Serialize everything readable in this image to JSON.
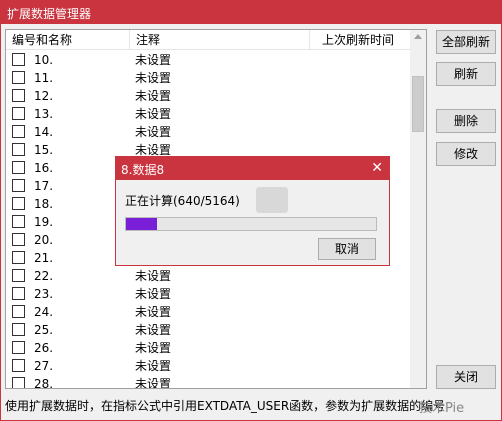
{
  "window": {
    "title": "扩展数据管理器"
  },
  "list": {
    "columns": [
      "编号和名称",
      "注释",
      "上次刷新时间"
    ],
    "rows": [
      {
        "num": "10.",
        "note": "未设置"
      },
      {
        "num": "11.",
        "note": "未设置"
      },
      {
        "num": "12.",
        "note": "未设置"
      },
      {
        "num": "13.",
        "note": "未设置"
      },
      {
        "num": "14.",
        "note": "未设置"
      },
      {
        "num": "15.",
        "note": "未设置"
      },
      {
        "num": "16.",
        "note": ""
      },
      {
        "num": "17.",
        "note": ""
      },
      {
        "num": "18.",
        "note": ""
      },
      {
        "num": "19.",
        "note": ""
      },
      {
        "num": "20.",
        "note": ""
      },
      {
        "num": "21.",
        "note": ""
      },
      {
        "num": "22.",
        "note": "未设置"
      },
      {
        "num": "23.",
        "note": "未设置"
      },
      {
        "num": "24.",
        "note": "未设置"
      },
      {
        "num": "25.",
        "note": "未设置"
      },
      {
        "num": "26.",
        "note": "未设置"
      },
      {
        "num": "27.",
        "note": "未设置"
      },
      {
        "num": "28.",
        "note": "未设置"
      }
    ]
  },
  "buttons": {
    "refresh_all": "全部刷新",
    "refresh": "刷新",
    "delete": "删除",
    "modify": "修改",
    "close": "关闭"
  },
  "status": "使用扩展数据时，在指标公式中引用EXTDATA_USER函数，参数为扩展数据的编号",
  "watermark": "技术Pie",
  "dialog": {
    "title": "8.数据8",
    "message": "正在计算(640/5164)",
    "progress": 0.124,
    "cancel": "取消",
    "close_glyph": "✕"
  },
  "colors": {
    "accent": "#c9343e",
    "progress": "#7a1fd8"
  }
}
